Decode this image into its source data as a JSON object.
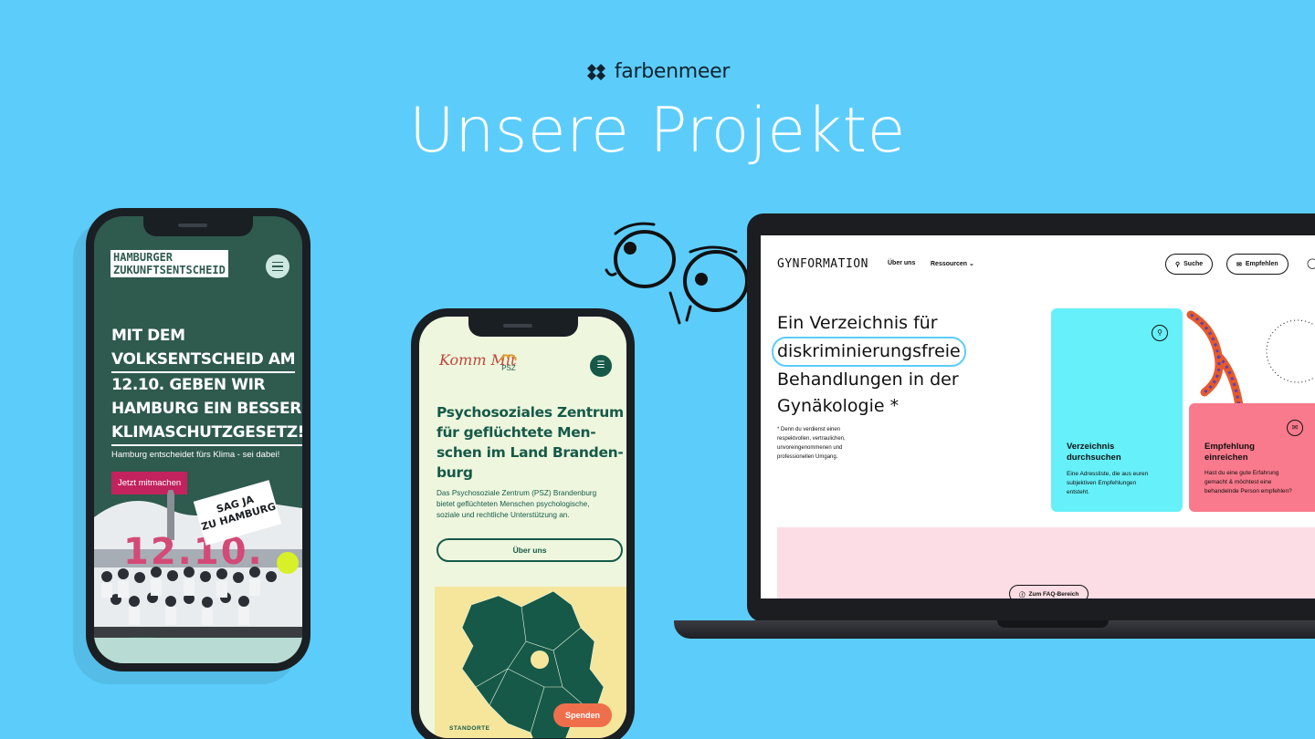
{
  "brand": {
    "name": "farbenmeer"
  },
  "headline": "Unsere Projekte",
  "project_hamburg": {
    "logo_line1": "HAMBURGER",
    "logo_line2": "ZUKUNFTSENTSCHEID",
    "title_lines": [
      "MIT DEM",
      "VOLKSENTSCHEID AM",
      "12.10. GEBEN WIR",
      "HAMBURG EIN BESSERES",
      "KLIMASCHUTZGESETZ!"
    ],
    "subtitle": "Hamburg entscheidet fürs Klima - sei dabei!",
    "cta_label": "Jetzt mitmachen",
    "sign_line1": "SAG JA",
    "sign_line2": "ZU HAMBURG",
    "date": "12.10."
  },
  "project_kommmit": {
    "logo": "Komm Mit",
    "logo_badge": "PSZ",
    "title_lines": [
      "Psychosoziales Zentrum",
      "für geflüchtete Men-",
      "schen im Land Branden-",
      "burg"
    ],
    "body_lines": [
      "Das Psychosoziale Zentrum (PSZ) Brandenburg",
      "bietet geflüchteten Menschen psychologische,",
      "soziale und rechtliche Unterstützung an."
    ],
    "about_button": "Über uns",
    "locations_label": "STANDORTE",
    "donate_button": "Spenden"
  },
  "project_gynformation": {
    "logo": "GYNFORMATION",
    "nav": {
      "about": "Über uns",
      "resources": "Ressourcen"
    },
    "search_label": "Suche",
    "recommend_label": "Empfehlen",
    "title_line1": "Ein Verzeichnis für",
    "title_highlight": "diskriminierungsfreie",
    "title_line3": "Behandlungen in der",
    "title_line4": "Gynäkologie *",
    "note_lines": [
      "* Denn du verdienst einen",
      "respektvollen, vertraulichen,",
      "unvoreingenommenen und",
      "professionellen Umgang."
    ],
    "card_search": {
      "title_line1": "Verzeichnis",
      "title_line2": "durchsuchen",
      "text_lines": [
        "Eine Adressliste, die aus euren",
        "subjektiven Empfehlungen",
        "entsteht."
      ]
    },
    "card_recommend": {
      "title_line1": "Empfehlung",
      "title_line2": "einreichen",
      "text_lines": [
        "Hast du eine gute Erfahrung",
        "gemacht & möchtest eine",
        "behandelnde Person empfehlen?"
      ]
    },
    "faq_button": "Zum FAQ-Bereich"
  }
}
